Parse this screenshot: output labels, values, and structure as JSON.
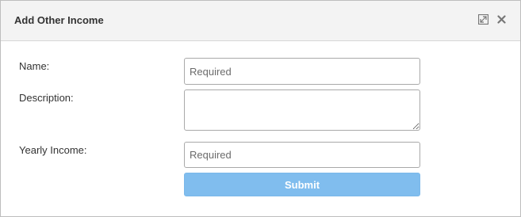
{
  "dialog": {
    "title": "Add Other Income",
    "expand_icon": "expand-icon",
    "close_icon": "close-icon"
  },
  "form": {
    "name_label": "Name:",
    "name_placeholder": "Required",
    "name_value": "",
    "description_label": "Description:",
    "description_value": "",
    "income_label": "Yearly Income:",
    "income_placeholder": "Required",
    "income_value": "",
    "submit_label": "Submit"
  },
  "colors": {
    "header_bg": "#f3f3f3",
    "submit_bg": "#80bdee",
    "border": "#bdbdbd"
  }
}
